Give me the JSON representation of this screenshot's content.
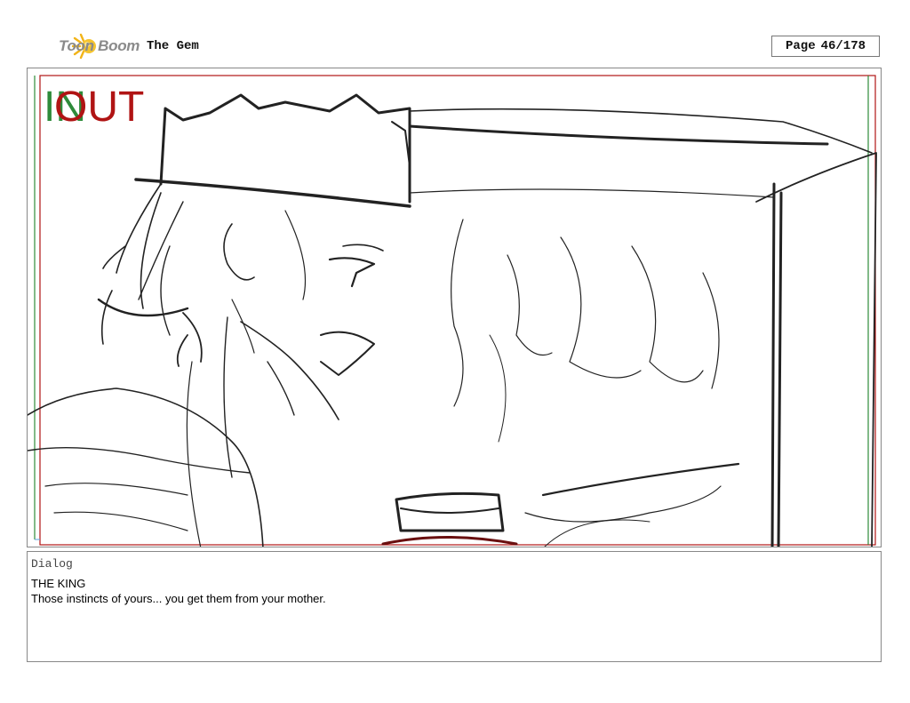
{
  "header": {
    "logo_text": "Toon Boom",
    "project_title": "The Gem",
    "page_label": "Page",
    "page_number": "46/178"
  },
  "panel": {
    "in_label": "IN",
    "out_label": "OUT",
    "colors": {
      "in": "#2e8b3a",
      "out": "#b01414"
    }
  },
  "dialog": {
    "section_label": "Dialog",
    "character": "THE KING",
    "line": "Those instincts of yours... you get them from your mother."
  }
}
